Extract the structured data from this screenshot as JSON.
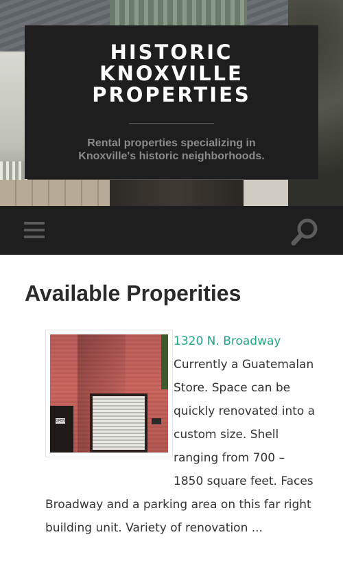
{
  "header": {
    "title_lines": [
      "HISTORIC",
      "KNOXVILLE",
      "PROPERTIES"
    ],
    "tagline_lines": [
      "Rental properties specializing in",
      "Knoxville's historic neighborhoods."
    ]
  },
  "nav": {
    "menu_icon": "hamburger-menu-icon",
    "search_icon": "search-icon"
  },
  "main": {
    "page_title": "Available Properities",
    "listing": {
      "title": "1320 N. Broadway",
      "image_sign_text": "OPEN",
      "description_lines": [
        "Currently a Guatemalan",
        "Store. Space can be",
        "quickly renovated into a",
        "custom size.  Shell",
        "ranging from 700 –",
        "1850 square feet. Faces",
        "Broadway and a parking area on this far right",
        "building unit. Variety of renovation ..."
      ]
    }
  },
  "colors": {
    "header_bg": "#1e1e1e",
    "link": "#1fa784",
    "tagline": "#8a8a8a",
    "icon_gray": "#5c5c5c"
  }
}
